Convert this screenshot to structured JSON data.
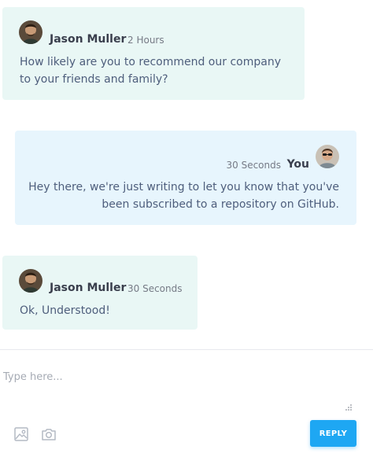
{
  "messages": [
    {
      "sender": "Jason Muller",
      "time": "2 Hours",
      "text_lines": [
        "How likely are you to recommend our company",
        "to your friends and family?"
      ],
      "direction": "incoming"
    },
    {
      "sender": "You",
      "time": "30 Seconds",
      "text_lines": [
        "Hey there, we're just writing to let you know that you've",
        "been subscribed to a repository on GitHub."
      ],
      "direction": "outgoing"
    },
    {
      "sender": "Jason Muller",
      "time": "30 Seconds",
      "text_lines": [
        "Ok, Understood!"
      ],
      "direction": "incoming"
    }
  ],
  "composer": {
    "placeholder": "Type here...",
    "value": ""
  },
  "toolbar": {
    "image_icon": "image-icon",
    "camera_icon": "camera-icon",
    "reply_label": "REPLY"
  },
  "colors": {
    "incoming_bg": "#e9f7f5",
    "outgoing_bg": "#e7f5fd",
    "accent": "#1ea7f3"
  }
}
